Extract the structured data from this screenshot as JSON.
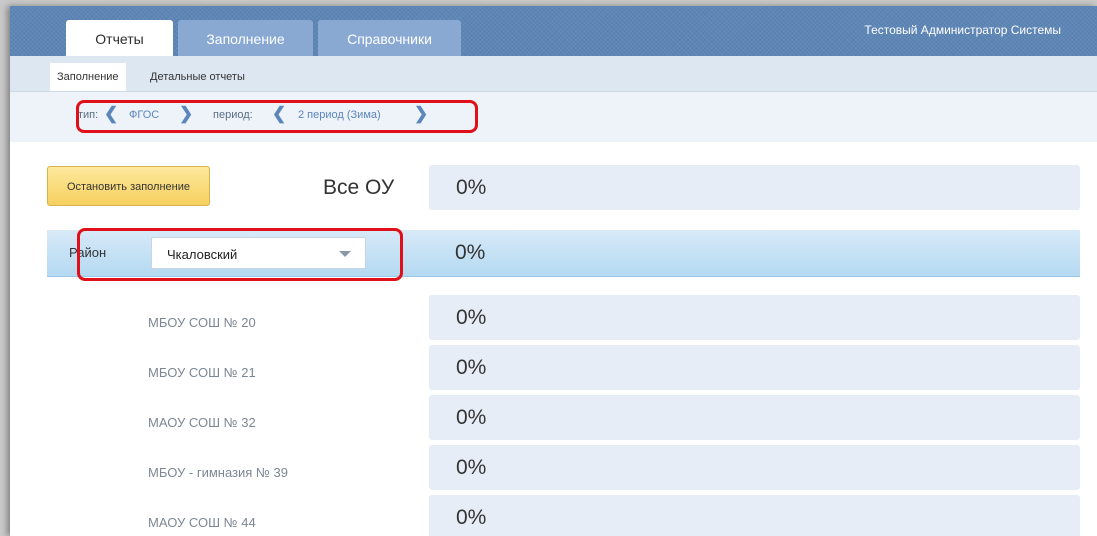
{
  "header": {
    "tabs": [
      {
        "label": "Отчеты",
        "active": true
      },
      {
        "label": "Заполнение",
        "active": false
      },
      {
        "label": "Справочники",
        "active": false
      }
    ],
    "user": "Тестовый Администратор Системы"
  },
  "subnav": {
    "items": [
      {
        "label": "Заполнение",
        "active": true
      },
      {
        "label": "Детальные отчеты",
        "active": false
      }
    ]
  },
  "filter": {
    "type_label": "тип:",
    "type_value": "ФГОС",
    "period_label": "период:",
    "period_value": "2 период (Зима)"
  },
  "main": {
    "stop_button": "Остановить заполнение",
    "all_label": "Все ОУ",
    "all_percent": "0%",
    "district_label": "Район",
    "district_value": "Чкаловский",
    "district_percent": "0%",
    "schools": [
      {
        "name": "МБОУ СОШ № 20",
        "percent": "0%"
      },
      {
        "name": "МБОУ СОШ № 21",
        "percent": "0%"
      },
      {
        "name": "МАОУ СОШ № 32",
        "percent": "0%"
      },
      {
        "name": "МБОУ - гимназия № 39",
        "percent": "0%"
      },
      {
        "name": "МАОУ СОШ № 44",
        "percent": "0%"
      }
    ]
  },
  "colors": {
    "header_blue": "#5d86b6",
    "highlight_red": "#e0101a",
    "button_yellow": "#f6d060",
    "district_blue": "#b4d9f2"
  },
  "icons": [
    "chevron-left-icon",
    "chevron-right-icon",
    "chevron-down-icon"
  ]
}
